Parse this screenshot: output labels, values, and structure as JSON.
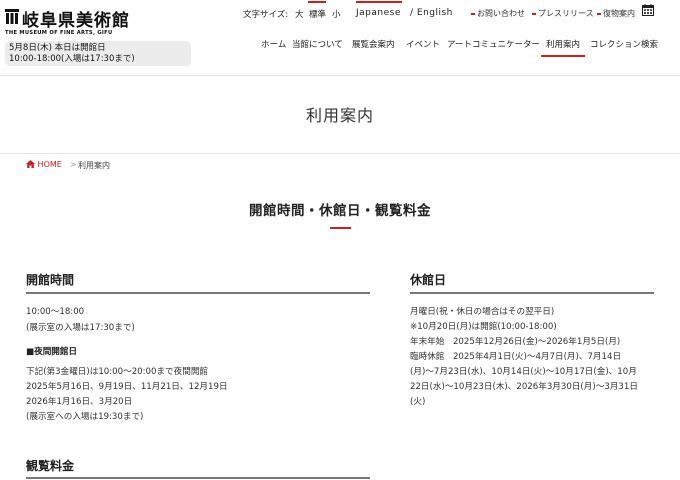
{
  "logo": {
    "jp": "岐阜県美術館",
    "en": "THE MUSEUM OF FINE ARTS, GIFU"
  },
  "status": {
    "line1": "5月8日(木) 本日は開館日",
    "line2": "10:00-18:00(入場は17:30まで)"
  },
  "utility": {
    "font_size_label": "文字サイズ:",
    "font_size_options": [
      "大",
      "標準",
      "小"
    ],
    "japanese": "Japanese",
    "english": "/ English",
    "links": [
      "お問い合わせ",
      "プレスリリース",
      "復物案内"
    ],
    "calendar_icon": "calendar-icon"
  },
  "nav": {
    "items": [
      "ホーム",
      "当館について",
      "展覧会案内",
      "イベント",
      "アートコミュニケーター",
      "利用案内",
      "コレクション検索"
    ],
    "active": "利用案内"
  },
  "page_title": "利用案内",
  "breadcrumb": {
    "home": "HOME",
    "separator": ">",
    "current": "利用案内"
  },
  "section_title": "開館時間・休館日・観覧料金",
  "hours": {
    "title": "開館時間",
    "time": "10:00〜18:00",
    "note": "(展示室の入場は17:30まで)",
    "night_label": "■夜間開館日",
    "night_lines": [
      "下記(第3金曜日)は10:00〜20:00まで夜間開館",
      "2025年5月16日、9月19日、11月21日、12月19日",
      "2026年1月16日、3月20日",
      "(展示室への入場は19:30まで)"
    ]
  },
  "closed": {
    "title": "休館日",
    "lines": [
      "月曜日(祝・休日の場合はその翌平日)",
      "※10月20日(月)は開館(10:00-18:00)",
      "年末年始　2025年12月26日(金)〜2026年1月5日(月)",
      "臨時休館　2025年4月1日(火)〜4月7日(月)、7月14日",
      "(月)〜7月23日(水)、10月14日(火)〜10月17日(金)、10月",
      "22日(水)〜10月23日(木)、2026年3月30日(月)〜3月31日",
      "(火)"
    ]
  },
  "fees": {
    "title": "観覧料金"
  },
  "colors": {
    "accent": "#c8201f",
    "status_bg": "#ececec",
    "rule": "#777777"
  }
}
